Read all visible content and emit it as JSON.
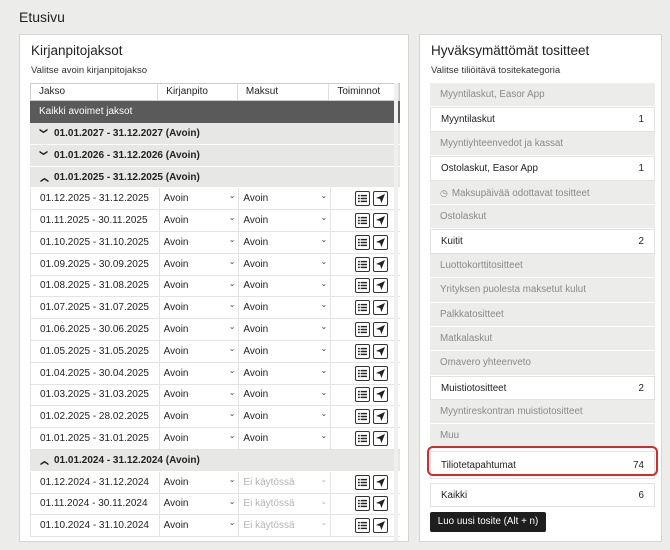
{
  "page": {
    "title": "Etusivu"
  },
  "left": {
    "title": "Kirjanpitojaksot",
    "subtitle": "Valitse avoin kirjanpitojakso",
    "columns": [
      "Jakso",
      "Kirjanpito",
      "Maksut",
      "Toiminnot"
    ],
    "all_periods_label": "Kaikki avoimet jaksot",
    "groups": {
      "g2027": "01.01.2027 - 31.12.2027 (Avoin)",
      "g2026": "01.01.2026 - 31.12.2026 (Avoin)",
      "g2025": "01.01.2025 - 31.12.2025 (Avoin)",
      "g2024": "01.01.2024 - 31.12.2024 (Avoin)"
    },
    "rows": [
      {
        "period": "01.12.2025 - 31.12.2025",
        "kirjanpito": "Avoin",
        "maksut": "Avoin"
      },
      {
        "period": "01.11.2025 - 30.11.2025",
        "kirjanpito": "Avoin",
        "maksut": "Avoin"
      },
      {
        "period": "01.10.2025 - 31.10.2025",
        "kirjanpito": "Avoin",
        "maksut": "Avoin"
      },
      {
        "period": "01.09.2025 - 30.09.2025",
        "kirjanpito": "Avoin",
        "maksut": "Avoin"
      },
      {
        "period": "01.08.2025 - 31.08.2025",
        "kirjanpito": "Avoin",
        "maksut": "Avoin"
      },
      {
        "period": "01.07.2025 - 31.07.2025",
        "kirjanpito": "Avoin",
        "maksut": "Avoin"
      },
      {
        "period": "01.06.2025 - 30.06.2025",
        "kirjanpito": "Avoin",
        "maksut": "Avoin"
      },
      {
        "period": "01.05.2025 - 31.05.2025",
        "kirjanpito": "Avoin",
        "maksut": "Avoin"
      },
      {
        "period": "01.04.2025 - 30.04.2025",
        "kirjanpito": "Avoin",
        "maksut": "Avoin"
      },
      {
        "period": "01.03.2025 - 31.03.2025",
        "kirjanpito": "Avoin",
        "maksut": "Avoin"
      },
      {
        "period": "01.02.2025 - 28.02.2025",
        "kirjanpito": "Avoin",
        "maksut": "Avoin"
      },
      {
        "period": "01.01.2025 - 31.01.2025",
        "kirjanpito": "Avoin",
        "maksut": "Avoin"
      }
    ],
    "rows2024": [
      {
        "period": "01.12.2024 - 31.12.2024",
        "kirjanpito": "Avoin",
        "maksut": "Ei käytössä"
      },
      {
        "period": "01.11.2024 - 30.11.2024",
        "kirjanpito": "Avoin",
        "maksut": "Ei käytössä"
      },
      {
        "period": "01.10.2024 - 31.10.2024",
        "kirjanpito": "Avoin",
        "maksut": "Ei käytössä"
      }
    ]
  },
  "right": {
    "title": "Hyväksymättömät tositteet",
    "subtitle": "Valitse tiliöitävä tositekategoria",
    "items": [
      {
        "label": "Myyntilaskut, Easor App",
        "count": ""
      },
      {
        "label": "Myyntilaskut",
        "count": "1"
      },
      {
        "label": "Myyntiyhteenvedot ja kassat",
        "count": ""
      },
      {
        "label": "Ostolaskut, Easor App",
        "count": "1"
      },
      {
        "label": "Maksupäivää odottavat tositteet",
        "count": ""
      },
      {
        "label": "Ostolaskut",
        "count": ""
      },
      {
        "label": "Kuitit",
        "count": "2"
      },
      {
        "label": "Luottokorttitositteet",
        "count": ""
      },
      {
        "label": "Yrityksen puolesta maksetut kulut",
        "count": ""
      },
      {
        "label": "Palkkatositteet",
        "count": ""
      },
      {
        "label": "Matkalaskut",
        "count": ""
      },
      {
        "label": "Omavero yhteenveto",
        "count": ""
      },
      {
        "label": "Muistiotositteet",
        "count": "2"
      },
      {
        "label": "Myyntireskontran muistiotositteet",
        "count": ""
      },
      {
        "label": "Muu",
        "count": ""
      },
      {
        "label": "Tiliotetapahtumat",
        "count": "74"
      },
      {
        "label": "Kaikki",
        "count": "6"
      }
    ],
    "new_button": "Luo uusi tosite (Alt + n)"
  },
  "colors": {
    "highlight": "#d32b2b",
    "dark_button": "#1e1e1e",
    "all_row": "#5a5a5a"
  }
}
